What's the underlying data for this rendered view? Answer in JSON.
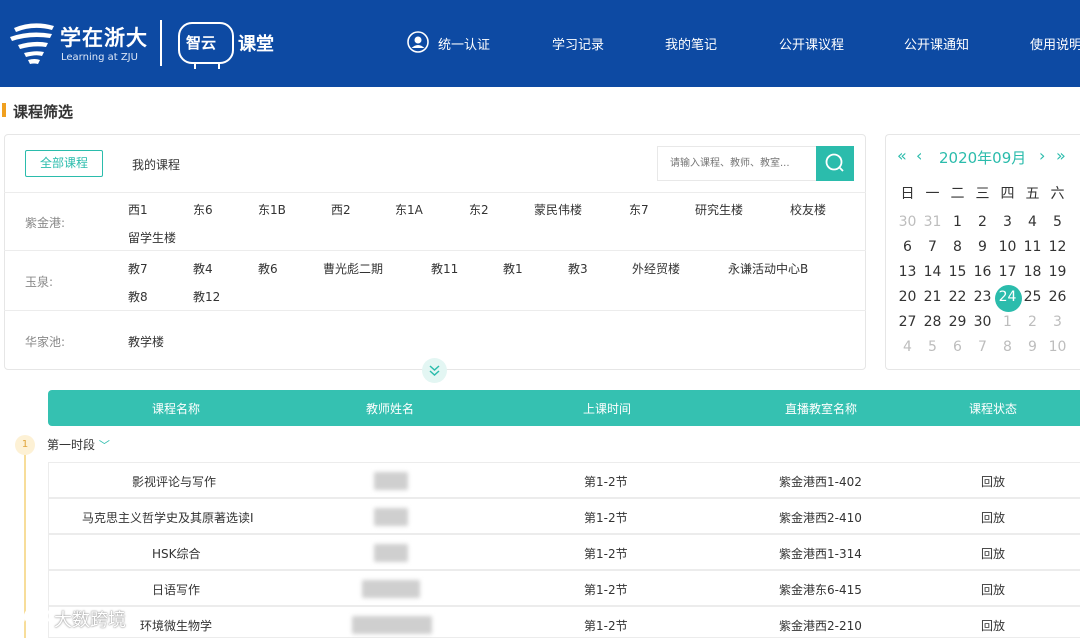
{
  "header": {
    "logo_title": "学在浙大",
    "logo_subtitle": "Learning at ZJU",
    "product_badge": "智云",
    "product_name": "课堂",
    "nav": [
      {
        "label": "统一认证"
      },
      {
        "label": "学习记录"
      },
      {
        "label": "我的笔记"
      },
      {
        "label": "公开课议程"
      },
      {
        "label": "公开课通知"
      },
      {
        "label": "使用说明"
      }
    ],
    "colors": {
      "bar": "#0d4aa3",
      "accent": "#2bbcac"
    }
  },
  "filter": {
    "section_title": "课程筛选",
    "tab_all": "全部课程",
    "tab_mine": "我的课程",
    "search_placeholder": "请输入课程、教师、教室...",
    "campuses": [
      {
        "name": "紫金港:",
        "buildings": [
          "西1",
          "东6",
          "东1B",
          "西2",
          "东1A",
          "东2",
          "蒙民伟楼",
          "东7",
          "研究生楼",
          "校友楼",
          "留学生楼"
        ]
      },
      {
        "name": "玉泉:",
        "buildings": [
          "教7",
          "教4",
          "教6",
          "曹光彪二期",
          "教11",
          "教1",
          "教3",
          "外经贸楼",
          "永谦活动中心B",
          "教8",
          "教12"
        ]
      },
      {
        "name": "华家池:",
        "buildings": [
          "教学楼"
        ]
      }
    ]
  },
  "calendar": {
    "month_label": "2020年09月",
    "weekdays": [
      "日",
      "一",
      "二",
      "三",
      "四",
      "五",
      "六"
    ],
    "weeks": [
      [
        "30",
        "31",
        "1",
        "2",
        "3",
        "4",
        "5"
      ],
      [
        "6",
        "7",
        "8",
        "9",
        "10",
        "11",
        "12"
      ],
      [
        "13",
        "14",
        "15",
        "16",
        "17",
        "18",
        "19"
      ],
      [
        "20",
        "21",
        "22",
        "23",
        "24",
        "25",
        "26"
      ],
      [
        "27",
        "28",
        "29",
        "30",
        "1",
        "2",
        "3"
      ],
      [
        "4",
        "5",
        "6",
        "7",
        "8",
        "9",
        "10"
      ]
    ],
    "selected": "24"
  },
  "table": {
    "columns": [
      "课程名称",
      "教师姓名",
      "上课时间",
      "直播教室名称",
      "课程状态"
    ],
    "period_index": "1",
    "period_label": "第一时段",
    "rows": [
      {
        "course": "影视评论与写作",
        "time": "第1-2节",
        "room": "紫金港西1-402",
        "status": "回放"
      },
      {
        "course": "马克思主义哲学史及其原著选读Ⅰ",
        "time": "第1-2节",
        "room": "紫金港西2-410",
        "status": "回放"
      },
      {
        "course": "HSK综合",
        "time": "第1-2节",
        "room": "紫金港西1-314",
        "status": "回放"
      },
      {
        "course": "日语写作",
        "time": "第1-2节",
        "room": "紫金港东6-415",
        "status": "回放"
      },
      {
        "course": "环境微生物学",
        "time": "第1-2节",
        "room": "紫金港西2-210",
        "status": "回放"
      }
    ]
  },
  "watermark": "大数跨境"
}
